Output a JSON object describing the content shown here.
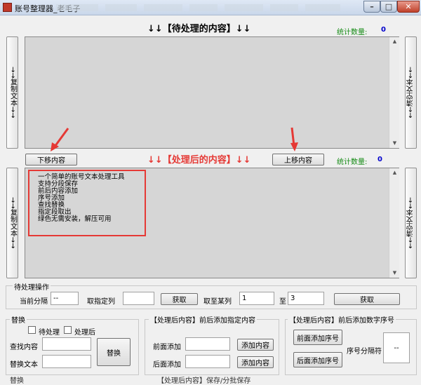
{
  "window": {
    "title": "账号整理器_老毛子",
    "minimize": "–",
    "maximize": "□",
    "close": "✕"
  },
  "top": {
    "heading": "↓↓【待处理的内容】↓↓",
    "stat_label": "统计数量:",
    "stat_value": "0",
    "left_btn": "→→复制文本→→",
    "right_btn": "←←清空文本←←"
  },
  "middle": {
    "move_down": "下移内容",
    "heading": "↓↓【处理后的内容】↓↓",
    "move_up": "上移内容",
    "stat_label": "统计数量:",
    "stat_value": "0"
  },
  "bottom_area": {
    "left_btn": "→→复制文本→→",
    "right_btn": "←←清空文本←←",
    "lines": [
      "一个简单的账号文本处理工具",
      "支持分段保存",
      "前后内容添加",
      "序号添加",
      "查找替换",
      "指定段取出",
      "绿色无需安装，解压可用"
    ]
  },
  "pending_ops": {
    "title": "待处理操作",
    "separator_label": "当前分隔",
    "separator_value": "--",
    "take_col_label": "取指定列",
    "take_col_value": "",
    "get_btn_1": "获取",
    "take_range_label": "取至某列",
    "range_from": "1",
    "range_to_label": "至",
    "range_to": "3",
    "get_btn_2": "获取"
  },
  "replace_group": {
    "title": "替换",
    "check_pending": "待处理",
    "check_processed": "处理后",
    "find_label": "查找内容",
    "find_value": "",
    "replace_label": "替换文本",
    "replace_value": "",
    "replace_btn": "替换"
  },
  "add_content_group": {
    "title": "【处理后内容】前后添加指定内容",
    "prefix_label": "前面添加",
    "prefix_value": "",
    "prefix_btn": "添加内容",
    "suffix_label": "后面添加",
    "suffix_value": "",
    "suffix_btn": "添加内容"
  },
  "add_seq_group": {
    "title": "【处理后内容】前后添加数字序号",
    "prefix_btn": "前面添加序号",
    "suffix_btn": "后面添加序号",
    "sep_label": "序号分隔符",
    "sep_value": "--"
  },
  "footer": {
    "left_label": "替换",
    "center_label": "【处理后内容】保存/分批保存"
  },
  "colors": {
    "accent_red": "#e53935",
    "stat_green": "#138a13",
    "stat_blue": "#0000cc"
  }
}
